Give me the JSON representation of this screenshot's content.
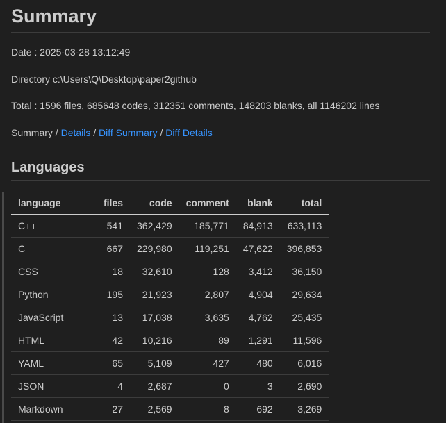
{
  "summary": {
    "title": "Summary",
    "date_label": "Date : 2025-03-28 13:12:49",
    "directory_label": "Directory c:\\Users\\Q\\Desktop\\paper2github",
    "total_label": "Total : 1596 files, 685648 codes, 312351 comments, 148203 blanks, all 1146202 lines"
  },
  "nav": {
    "current": "Summary",
    "separator": " / ",
    "links": [
      "Details",
      "Diff Summary",
      "Diff Details"
    ]
  },
  "languages": {
    "title": "Languages",
    "columns": [
      "language",
      "files",
      "code",
      "comment",
      "blank",
      "total"
    ],
    "rows": [
      [
        "C++",
        "541",
        "362,429",
        "185,771",
        "84,913",
        "633,113"
      ],
      [
        "C",
        "667",
        "229,980",
        "119,251",
        "47,622",
        "396,853"
      ],
      [
        "CSS",
        "18",
        "32,610",
        "128",
        "3,412",
        "36,150"
      ],
      [
        "Python",
        "195",
        "21,923",
        "2,807",
        "4,904",
        "29,634"
      ],
      [
        "JavaScript",
        "13",
        "17,038",
        "3,635",
        "4,762",
        "25,435"
      ],
      [
        "HTML",
        "42",
        "10,216",
        "89",
        "1,291",
        "11,596"
      ],
      [
        "YAML",
        "65",
        "5,109",
        "427",
        "480",
        "6,016"
      ],
      [
        "JSON",
        "4",
        "2,687",
        "0",
        "3",
        "2,690"
      ],
      [
        "Markdown",
        "27",
        "2,569",
        "8",
        "692",
        "3,269"
      ]
    ]
  },
  "colors": {
    "background": "#1f1f1f",
    "text": "#cccccc",
    "link": "#3794ff",
    "divider": "#3c3c3c"
  }
}
